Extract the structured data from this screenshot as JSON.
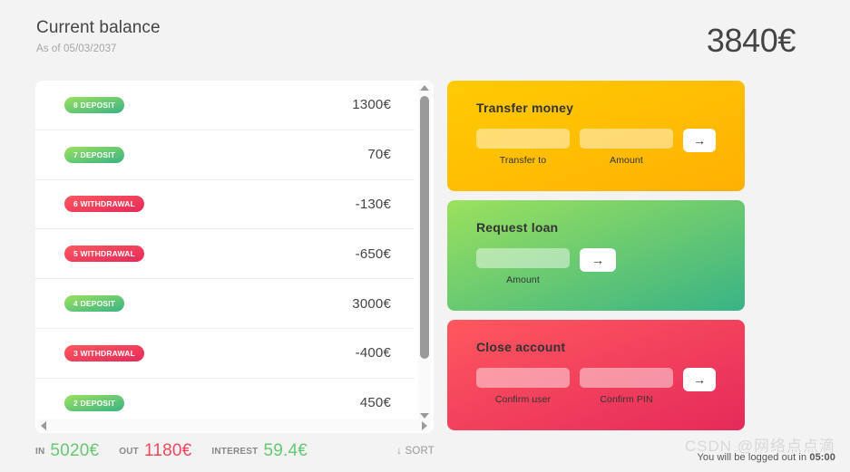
{
  "header": {
    "title": "Current balance",
    "subtitle": "As of 05/03/2037",
    "balance": "3840€"
  },
  "movements": [
    {
      "label": "8 DEPOSIT",
      "type": "deposit",
      "value": "1300€"
    },
    {
      "label": "7 DEPOSIT",
      "type": "deposit",
      "value": "70€"
    },
    {
      "label": "6 WITHDRAWAL",
      "type": "withdrawal",
      "value": "-130€"
    },
    {
      "label": "5 WITHDRAWAL",
      "type": "withdrawal",
      "value": "-650€"
    },
    {
      "label": "4 DEPOSIT",
      "type": "deposit",
      "value": "3000€"
    },
    {
      "label": "3 WITHDRAWAL",
      "type": "withdrawal",
      "value": "-400€"
    },
    {
      "label": "2 DEPOSIT",
      "type": "deposit",
      "value": "450€"
    }
  ],
  "operations": {
    "transfer": {
      "title": "Transfer money",
      "to_label": "Transfer to",
      "to_value": "",
      "amount_label": "Amount",
      "amount_value": "",
      "button": "→",
      "color": "#ffcb03"
    },
    "loan": {
      "title": "Request loan",
      "amount_label": "Amount",
      "amount_value": "",
      "button": "→",
      "color": "#9be15d"
    },
    "close": {
      "title": "Close account",
      "user_label": "Confirm user",
      "user_value": "",
      "pin_label": "Confirm PIN",
      "pin_value": "",
      "button": "→",
      "color": "#ff585f"
    }
  },
  "summary": {
    "in_label": "IN",
    "in_value": "5020€",
    "out_label": "OUT",
    "out_value": "1180€",
    "interest_label": "INTEREST",
    "interest_value": "59.4€",
    "sort_label": "↓ SORT"
  },
  "footer": {
    "logout_text": "You will be logged out in",
    "logout_time": "05:00",
    "watermark": "CSDN @网络点点滴"
  }
}
